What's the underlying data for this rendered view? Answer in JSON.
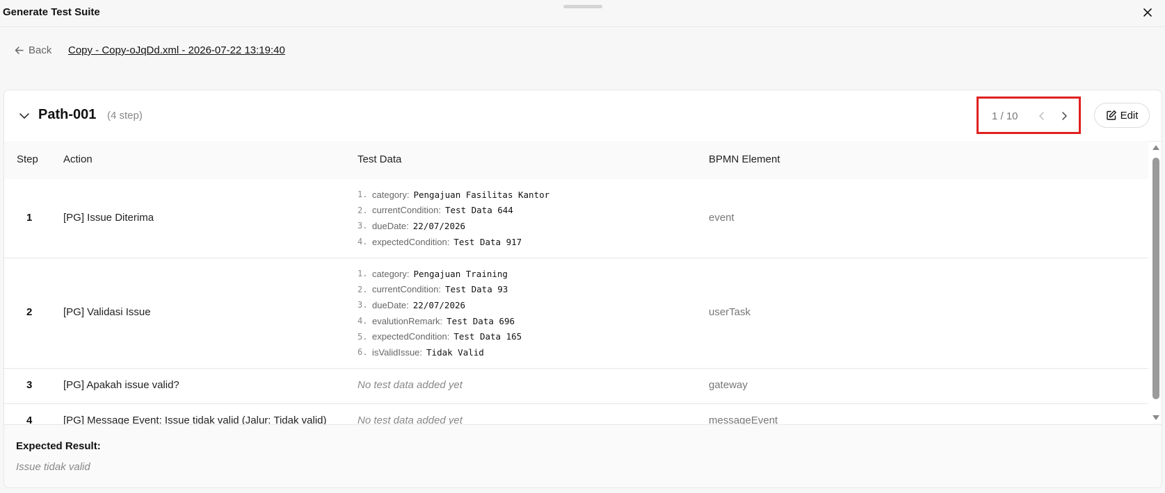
{
  "modal": {
    "title": "Generate Test Suite"
  },
  "nav": {
    "back_label": "Back",
    "file_name": "Copy - Copy-oJqDd.xml - 2026-07-22 13:19:40"
  },
  "path": {
    "title": "Path-001",
    "step_count": "(4 step)",
    "page_indicator": "1 / 10",
    "edit_label": "Edit"
  },
  "table": {
    "headers": {
      "step": "Step",
      "action": "Action",
      "test_data": "Test Data",
      "bpmn_element": "BPMN Element"
    },
    "rows": [
      {
        "step": "1",
        "action": "[PG] Issue Diterima",
        "bpmn_element": "event",
        "test_data": [
          {
            "idx": "1.",
            "key": "category:",
            "value": "Pengajuan Fasilitas Kantor"
          },
          {
            "idx": "2.",
            "key": "currentCondition:",
            "value": "Test Data 644"
          },
          {
            "idx": "3.",
            "key": "dueDate:",
            "value": "22/07/2026"
          },
          {
            "idx": "4.",
            "key": "expectedCondition:",
            "value": "Test Data 917"
          }
        ]
      },
      {
        "step": "2",
        "action": "[PG] Validasi Issue",
        "bpmn_element": "userTask",
        "test_data": [
          {
            "idx": "1.",
            "key": "category:",
            "value": "Pengajuan Training"
          },
          {
            "idx": "2.",
            "key": "currentCondition:",
            "value": "Test Data 93"
          },
          {
            "idx": "3.",
            "key": "dueDate:",
            "value": "22/07/2026"
          },
          {
            "idx": "4.",
            "key": "evalutionRemark:",
            "value": "Test Data 696"
          },
          {
            "idx": "5.",
            "key": "expectedCondition:",
            "value": "Test Data 165"
          },
          {
            "idx": "6.",
            "key": "isValidIssue:",
            "value": "Tidak Valid"
          }
        ]
      },
      {
        "step": "3",
        "action": "[PG] Apakah issue valid?",
        "bpmn_element": "gateway",
        "empty_text": "No test data added yet"
      },
      {
        "step": "4",
        "action": "[PG] Message Event: Issue tidak valid (Jalur: Tidak valid)",
        "bpmn_element": "messageEvent",
        "empty_text": "No test data added yet"
      }
    ]
  },
  "expected": {
    "label": "Expected Result:",
    "value": "Issue tidak valid"
  },
  "colors": {
    "highlight_border": "#e02020",
    "muted_text": "#888888"
  },
  "icons": {
    "close": "close-icon",
    "back": "arrow-left-icon",
    "collapse": "chevron-down-icon",
    "prev": "chevron-left-icon",
    "next": "chevron-right-icon",
    "edit": "edit-icon"
  }
}
